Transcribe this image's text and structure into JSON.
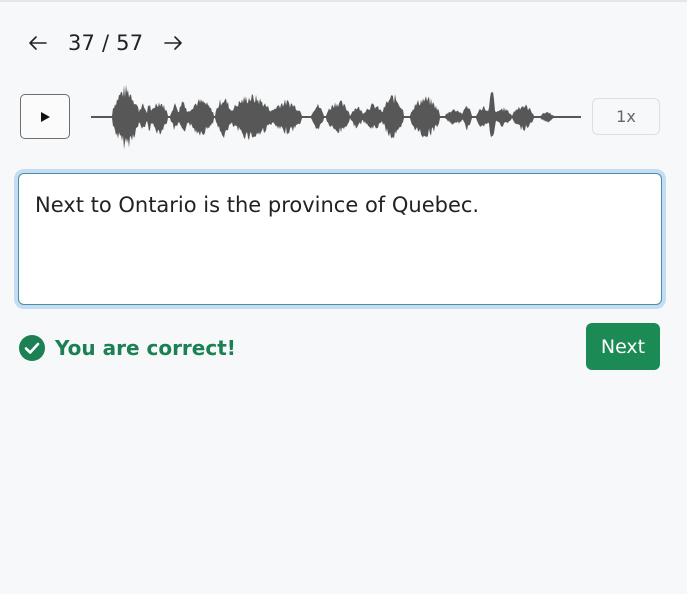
{
  "navigation": {
    "counter": "37 / 57",
    "prev_icon": "arrow-left-icon",
    "next_icon": "arrow-right-icon"
  },
  "player": {
    "play_icon": "play-icon",
    "speed_label": "1x"
  },
  "answer": {
    "text": "Next to Ontario is the province of Quebec."
  },
  "feedback": {
    "message": "You are correct!",
    "icon": "check-circle-icon",
    "color": "#1b8054"
  },
  "actions": {
    "next_label": "Next",
    "next_color": "#1b8a55"
  }
}
